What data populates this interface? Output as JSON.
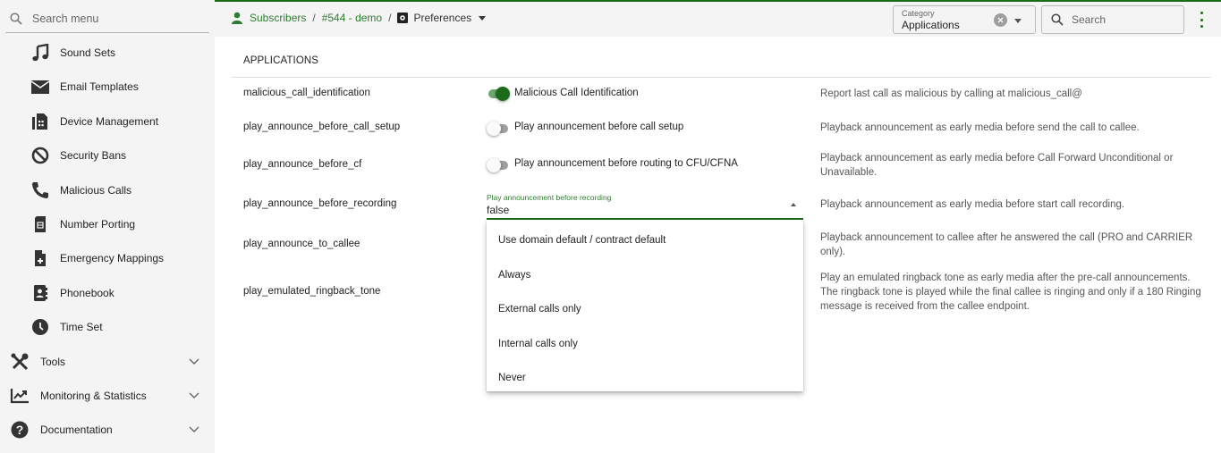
{
  "sidebar": {
    "search_placeholder": "Search menu",
    "sub_items": [
      {
        "label": "Sound Sets",
        "icon": "music-note-icon"
      },
      {
        "label": "Email Templates",
        "icon": "envelope-icon"
      },
      {
        "label": "Device Management",
        "icon": "fax-icon"
      },
      {
        "label": "Security Bans",
        "icon": "ban-icon"
      },
      {
        "label": "Malicious Calls",
        "icon": "phone-icon"
      },
      {
        "label": "Number Porting",
        "icon": "sim-card-icon"
      },
      {
        "label": "Emergency Mappings",
        "icon": "medical-file-icon"
      },
      {
        "label": "Phonebook",
        "icon": "contact-book-icon"
      },
      {
        "label": "Time Set",
        "icon": "clock-icon"
      }
    ],
    "top_items": [
      {
        "label": "Tools",
        "icon": "tools-icon"
      },
      {
        "label": "Monitoring & Statistics",
        "icon": "chart-line-icon"
      },
      {
        "label": "Documentation",
        "icon": "help-circle-icon"
      }
    ]
  },
  "header": {
    "breadcrumb": {
      "subscribers": "Subscribers",
      "separator": "/",
      "subscriber": "#544 - demo",
      "current": "Preferences"
    },
    "category": {
      "label": "Category",
      "value": "Applications"
    },
    "search_placeholder": "Search",
    "accent_color": "#1b6b1b"
  },
  "main": {
    "section_title": "APPLICATIONS",
    "preferences": [
      {
        "name": "malicious_call_identification",
        "control": "toggle",
        "toggle_label": "Malicious Call Identification",
        "checked": true,
        "description": "Report last call as malicious by calling at malicious_call@"
      },
      {
        "name": "play_announce_before_call_setup",
        "control": "toggle",
        "toggle_label": "Play announcement before call setup",
        "checked": false,
        "description": "Playback announcement as early media before send the call to callee."
      },
      {
        "name": "play_announce_before_cf",
        "control": "toggle",
        "toggle_label": "Play announcement before routing to CFU/CFNA",
        "checked": false,
        "description": "Playback announcement as early media before Call Forward Unconditional or Unavailable."
      },
      {
        "name": "play_announce_before_recording",
        "control": "select",
        "select_label": "Play announcement before recording",
        "value": "false",
        "description": "Playback announcement as early media before start call recording."
      },
      {
        "name": "play_announce_to_callee",
        "description": "Playback announcement to callee after he answered the call (PRO and CARRIER only)."
      },
      {
        "name": "play_emulated_ringback_tone",
        "description": "Play an emulated ringback tone as early media after the pre-call announcements. The ringback tone is played while the final callee is ringing and only if a 180 Ringing message is received from the callee endpoint."
      }
    ],
    "dropdown_options": [
      "Use domain default / contract default",
      "Always",
      "External calls only",
      "Internal calls only",
      "Never"
    ]
  }
}
